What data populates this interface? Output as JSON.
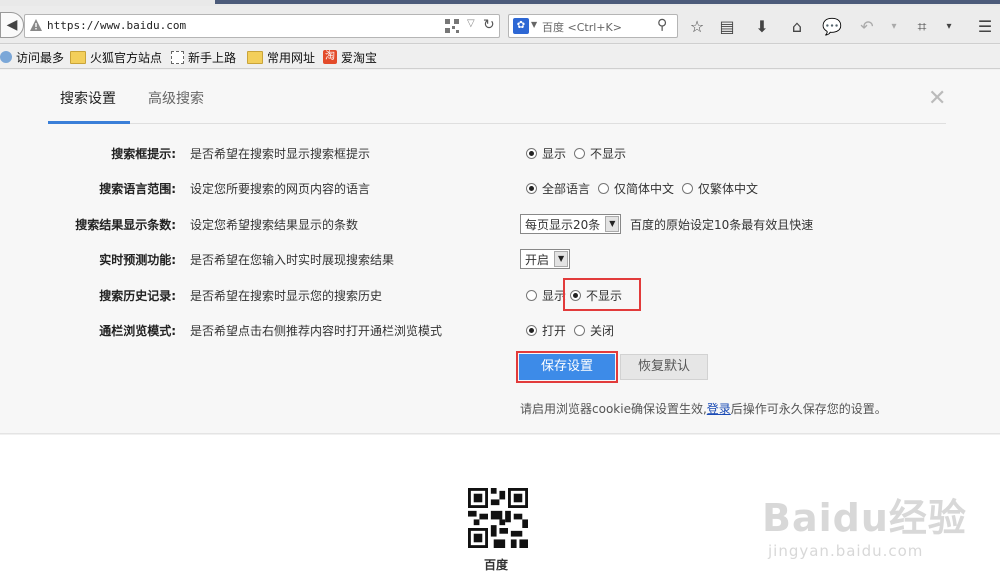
{
  "browser": {
    "url": "https://www.baidu.com",
    "search_placeholder": "百度 <Ctrl+K>",
    "bookmarks": [
      "访问最多",
      "火狐官方站点",
      "新手上路",
      "常用网址",
      "爱淘宝"
    ]
  },
  "panel": {
    "tabs": [
      "搜索设置",
      "高级搜索"
    ],
    "rows": [
      {
        "label": "搜索框提示:",
        "desc": "是否希望在搜索时显示搜索框提示",
        "options": [
          "显示",
          "不显示"
        ],
        "selected": 0
      },
      {
        "label": "搜索语言范围:",
        "desc": "设定您所要搜索的网页内容的语言",
        "options": [
          "全部语言",
          "仅简体中文",
          "仅繁体中文"
        ],
        "selected": 0
      },
      {
        "label": "搜索结果显示条数:",
        "desc": "设定您希望搜索结果显示的条数",
        "select": "每页显示20条",
        "hint": "百度的原始设定10条最有效且快速"
      },
      {
        "label": "实时预测功能:",
        "desc": "是否希望在您输入时实时展现搜索结果",
        "select": "开启"
      },
      {
        "label": "搜索历史记录:",
        "desc": "是否希望在搜索时显示您的搜索历史",
        "options": [
          "显示",
          "不显示"
        ],
        "selected": 1
      },
      {
        "label": "通栏浏览模式:",
        "desc": "是否希望点击右侧推荐内容时打开通栏浏览模式",
        "options": [
          "打开",
          "关闭"
        ],
        "selected": 0
      }
    ],
    "save_label": "保存设置",
    "reset_label": "恢复默认",
    "cookie_prefix": "请启用浏览器cookie确保设置生效,",
    "cookie_link": "登录",
    "cookie_suffix": "后操作可永久保存您的设置。"
  },
  "footer": {
    "qr_caption": "百度",
    "watermark_big": "Baidu经验",
    "watermark_small": "jingyan.baidu.com"
  },
  "colors": {
    "accent": "#3d8be8",
    "highlight": "#e23b3b",
    "link": "#1a4bb5"
  }
}
